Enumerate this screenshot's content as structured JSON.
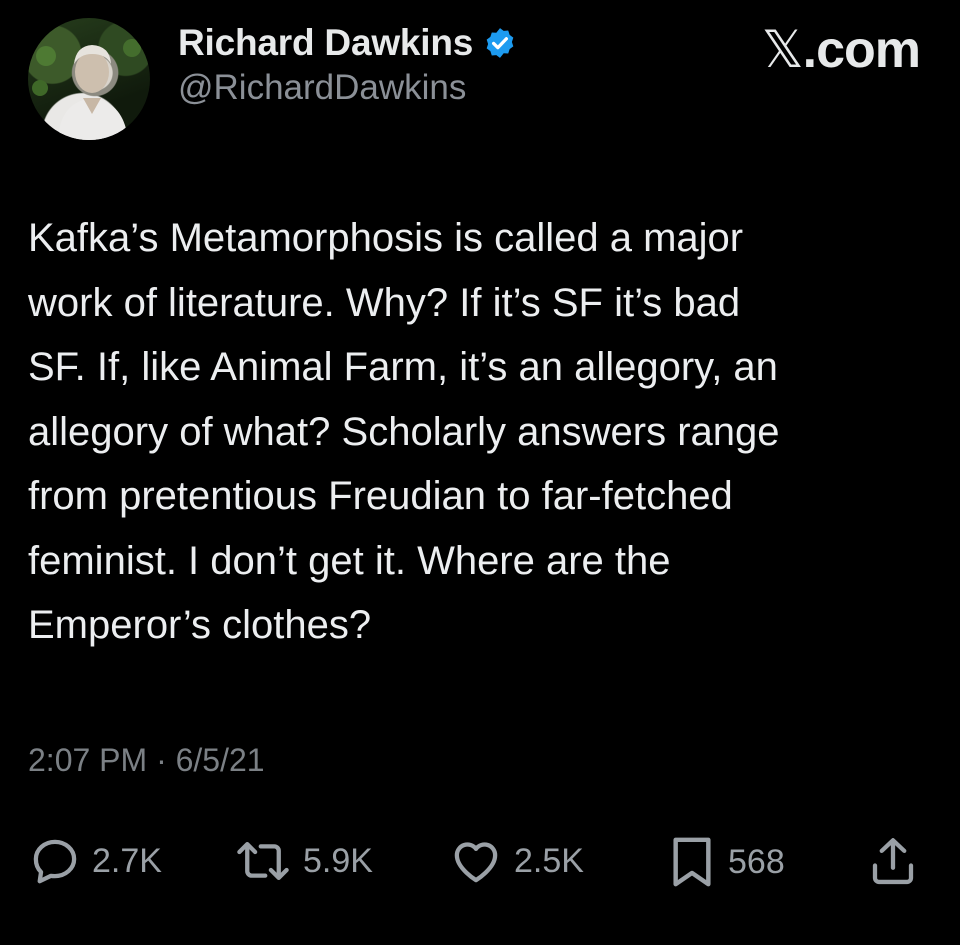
{
  "header": {
    "display_name": "Richard Dawkins",
    "handle": "@RichardDawkins",
    "source_logo_mark": "𝕏",
    "source_logo_domain": ".com",
    "avatar_icon": "profile-photo",
    "verified_icon": "verified-badge-icon",
    "verified_color": "#1d9bf0"
  },
  "tweet": {
    "text": "Kafka’s Metamorphosis is called a major\nwork of literature. Why? If it’s SF it’s bad\nSF. If, like Animal Farm, it’s an allegory, an\nallegory of what? Scholarly answers range\nfrom pretentious Freudian to far-fetched\nfeminist. I don’t get it. Where are the\nEmperor’s clothes?",
    "timestamp": "2:07 PM · 6/5/21"
  },
  "actions": {
    "replies": "2.7K",
    "retweets": "5.9K",
    "likes": "2.5K",
    "bookmarks": "568",
    "icons": [
      "reply-icon",
      "retweet-icon",
      "like-icon",
      "bookmark-icon",
      "share-icon"
    ]
  },
  "colors": {
    "background": "#000000",
    "primary_text": "#e7e9ea",
    "secondary_text": "#8b9097"
  }
}
